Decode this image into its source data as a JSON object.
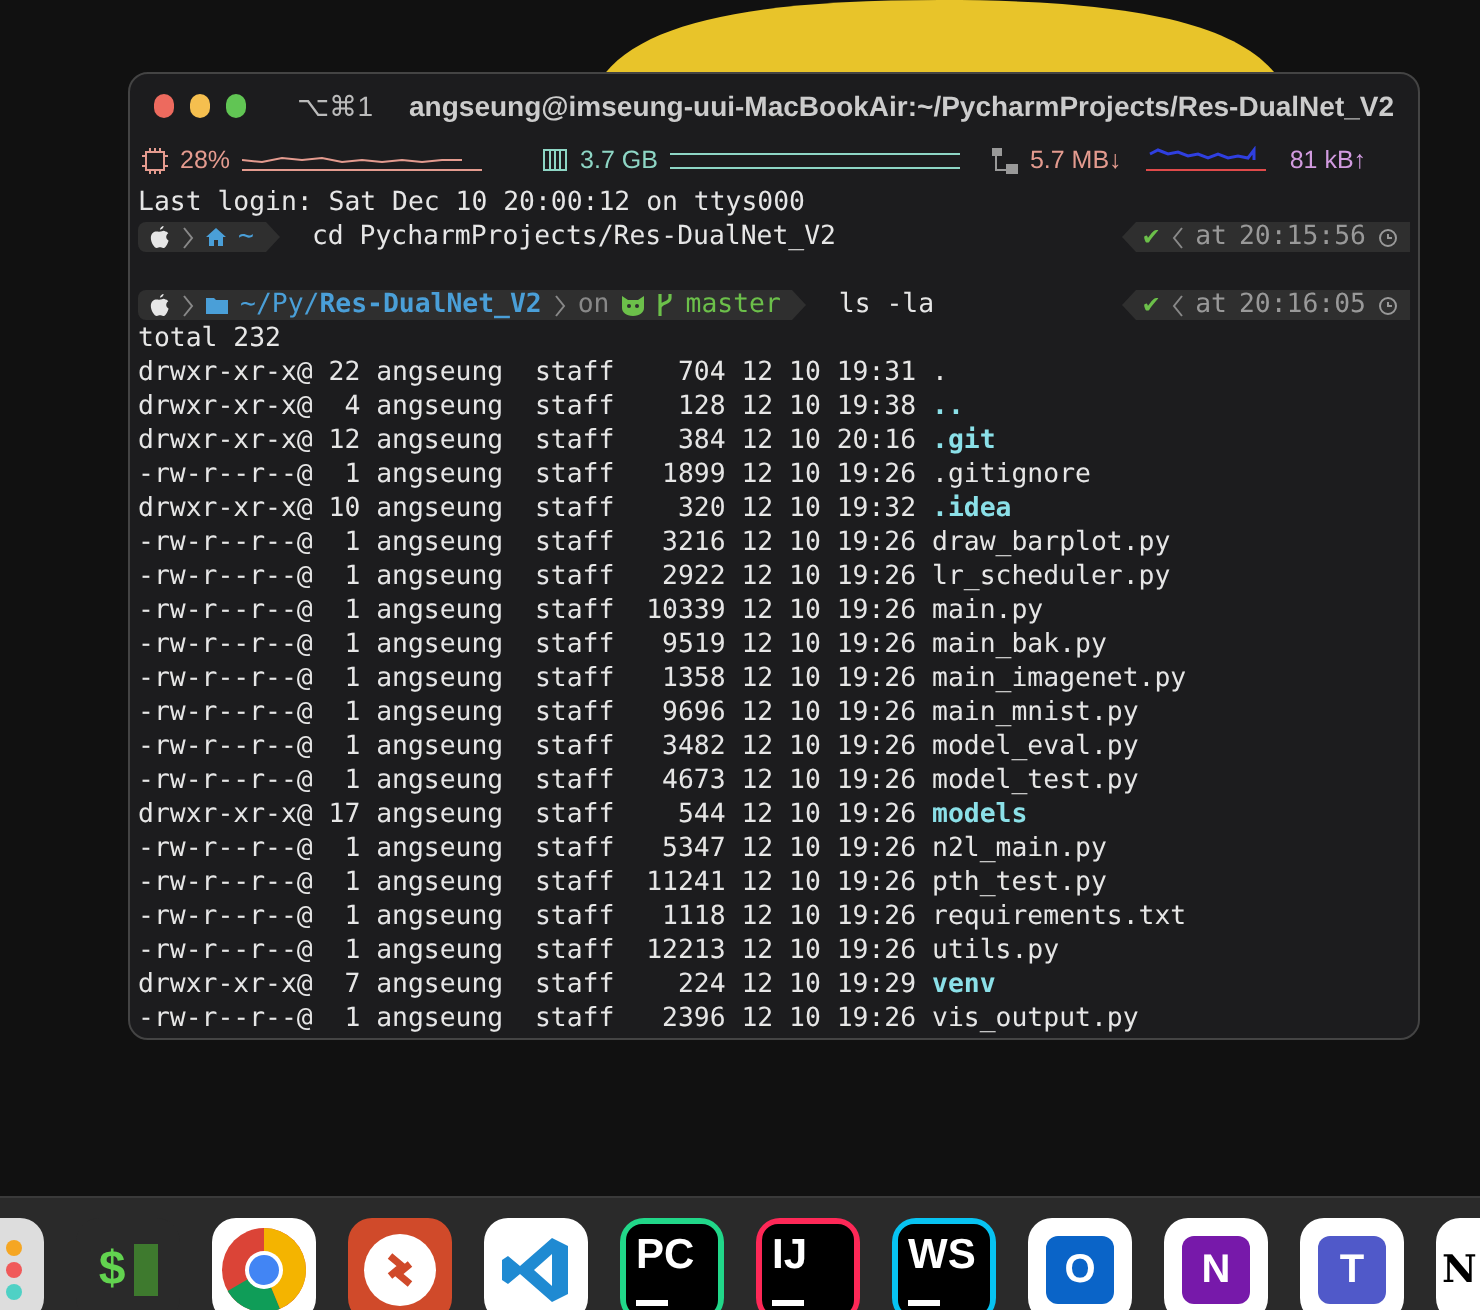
{
  "window": {
    "shortcut": "⌥⌘1",
    "title": "angseung@imseung-uui-MacBookAir:~/PycharmProjects/Res-DualNet_V2"
  },
  "status_bar": {
    "cpu": "28%",
    "memory": "3.7 GB",
    "download": "5.7 MB↓",
    "upload": "81 kB↑"
  },
  "last_login": "Last login: Sat Dec 10 20:00:12 on ttys000",
  "prompts": [
    {
      "dir_prefix": "~",
      "home": true,
      "command": "cd PycharmProjects/Res-DualNet_V2",
      "check": "✔",
      "at": "at",
      "time": "20:15:56"
    },
    {
      "dir_prefix": "~/Py/",
      "dir_bold": "Res-DualNet_V2",
      "home": false,
      "on": "on",
      "branch": "master",
      "command": "ls -la",
      "check": "✔",
      "at": "at",
      "time": "20:16:05"
    }
  ],
  "total": "total 232",
  "listing": [
    {
      "meta": "drwxr-xr-x@ 22 angseung  staff    704 12 10 19:31",
      "name": ".",
      "kind": "plain"
    },
    {
      "meta": "drwxr-xr-x@  4 angseung  staff    128 12 10 19:38",
      "name": "..",
      "kind": "dir"
    },
    {
      "meta": "drwxr-xr-x@ 12 angseung  staff    384 12 10 20:16",
      "name": ".git",
      "kind": "dir"
    },
    {
      "meta": "-rw-r--r--@  1 angseung  staff   1899 12 10 19:26",
      "name": ".gitignore",
      "kind": "plain"
    },
    {
      "meta": "drwxr-xr-x@ 10 angseung  staff    320 12 10 19:32",
      "name": ".idea",
      "kind": "dir"
    },
    {
      "meta": "-rw-r--r--@  1 angseung  staff   3216 12 10 19:26",
      "name": "draw_barplot.py",
      "kind": "plain"
    },
    {
      "meta": "-rw-r--r--@  1 angseung  staff   2922 12 10 19:26",
      "name": "lr_scheduler.py",
      "kind": "plain"
    },
    {
      "meta": "-rw-r--r--@  1 angseung  staff  10339 12 10 19:26",
      "name": "main.py",
      "kind": "plain"
    },
    {
      "meta": "-rw-r--r--@  1 angseung  staff   9519 12 10 19:26",
      "name": "main_bak.py",
      "kind": "plain"
    },
    {
      "meta": "-rw-r--r--@  1 angseung  staff   1358 12 10 19:26",
      "name": "main_imagenet.py",
      "kind": "plain"
    },
    {
      "meta": "-rw-r--r--@  1 angseung  staff   9696 12 10 19:26",
      "name": "main_mnist.py",
      "kind": "plain"
    },
    {
      "meta": "-rw-r--r--@  1 angseung  staff   3482 12 10 19:26",
      "name": "model_eval.py",
      "kind": "plain"
    },
    {
      "meta": "-rw-r--r--@  1 angseung  staff   4673 12 10 19:26",
      "name": "model_test.py",
      "kind": "plain"
    },
    {
      "meta": "drwxr-xr-x@ 17 angseung  staff    544 12 10 19:26",
      "name": "models",
      "kind": "dir"
    },
    {
      "meta": "-rw-r--r--@  1 angseung  staff   5347 12 10 19:26",
      "name": "n2l_main.py",
      "kind": "plain"
    },
    {
      "meta": "-rw-r--r--@  1 angseung  staff  11241 12 10 19:26",
      "name": "pth_test.py",
      "kind": "plain"
    },
    {
      "meta": "-rw-r--r--@  1 angseung  staff   1118 12 10 19:26",
      "name": "requirements.txt",
      "kind": "plain"
    },
    {
      "meta": "-rw-r--r--@  1 angseung  staff  12213 12 10 19:26",
      "name": "utils.py",
      "kind": "plain"
    },
    {
      "meta": "drwxr-xr-x@  7 angseung  staff    224 12 10 19:29",
      "name": "venv",
      "kind": "dir"
    },
    {
      "meta": "-rw-r--r--@  1 angseung  staff   2396 12 10 19:26",
      "name": "vis_output.py",
      "kind": "plain"
    }
  ],
  "dock": [
    {
      "kind": "launchpad"
    },
    {
      "kind": "terminal",
      "text": "$"
    },
    {
      "kind": "chrome"
    },
    {
      "kind": "remote"
    },
    {
      "kind": "vscode"
    },
    {
      "kind": "jetbrains",
      "text": "PC",
      "color": "#21d789"
    },
    {
      "kind": "jetbrains",
      "text": "IJ",
      "color": "#fe2857"
    },
    {
      "kind": "jetbrains",
      "text": "WS",
      "color": "#07c3f2"
    },
    {
      "kind": "office",
      "text": "O",
      "color": "#0a64c8"
    },
    {
      "kind": "office",
      "text": "N",
      "color": "#7719aa"
    },
    {
      "kind": "office",
      "text": "T",
      "color": "#5059c9"
    },
    {
      "kind": "notion",
      "text": "N"
    }
  ]
}
